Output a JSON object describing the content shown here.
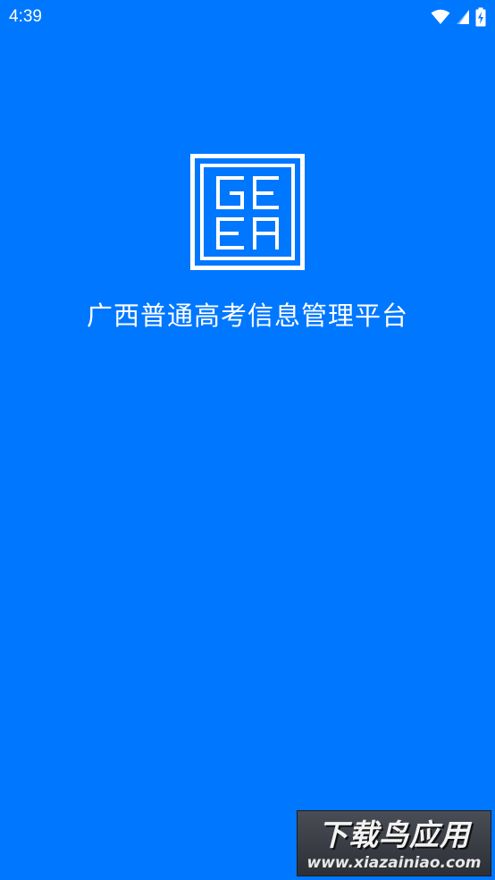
{
  "status_bar": {
    "time": "4:39",
    "icons": [
      "wifi-icon",
      "cellular-signal-icon",
      "battery-charging-icon"
    ]
  },
  "splash": {
    "logo_letters": [
      "G",
      "E",
      "E",
      "A"
    ],
    "title": "广西普通高考信息管理平台"
  },
  "watermark": {
    "cn_text": "下载鸟应用",
    "url_text": "www.xiazainiao.com"
  },
  "colors": {
    "background": "#0077ff",
    "foreground": "#ffffff"
  }
}
